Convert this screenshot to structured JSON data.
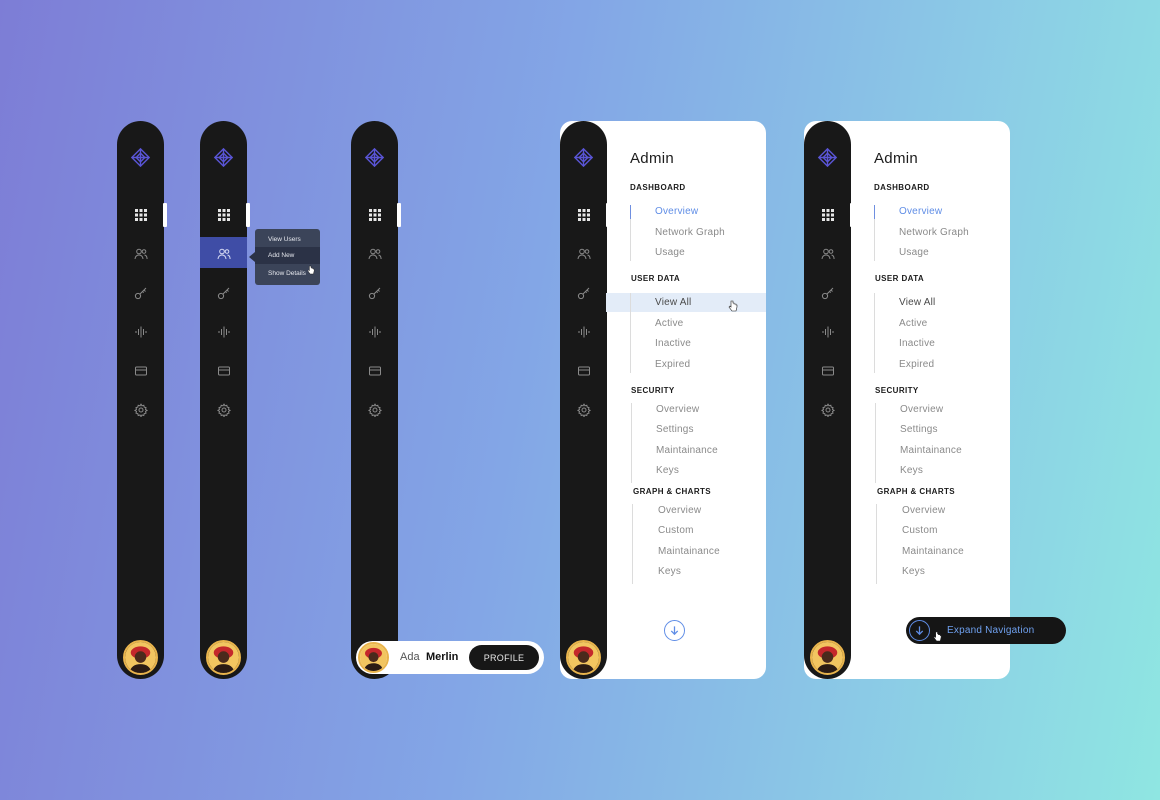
{
  "colors": {
    "rail": "#181818",
    "accent": "#5f8de6",
    "highlight": "#3f4da6",
    "popover": "#3b4459",
    "panel": "#ffffff"
  },
  "icons": {
    "logo": "diamond-grid-logo",
    "nav": [
      "grid-icon",
      "users-icon",
      "key-icon",
      "audio-wave-icon",
      "card-icon",
      "gear-icon"
    ]
  },
  "popover": {
    "items": [
      "View Users",
      "Add New",
      "Show Details"
    ]
  },
  "profile": {
    "first_name": "Ada",
    "last_name": "Merlin",
    "button_label": "PROFILE"
  },
  "admin": {
    "title": "Admin",
    "sections": [
      {
        "heading": "DASHBOARD",
        "items": [
          "Overview",
          "Network Graph",
          "Usage"
        ]
      },
      {
        "heading": "USER DATA",
        "items": [
          "View All",
          "Active",
          "Inactive",
          "Expired"
        ]
      },
      {
        "heading": "SECURITY",
        "items": [
          "Overview",
          "Settings",
          "Maintainance",
          "Keys"
        ]
      },
      {
        "heading": "GRAPH & CHARTS",
        "items": [
          "Overview",
          "Custom",
          "Maintainance",
          "Keys"
        ]
      }
    ]
  },
  "expand": {
    "label": "Expand Navigation"
  }
}
